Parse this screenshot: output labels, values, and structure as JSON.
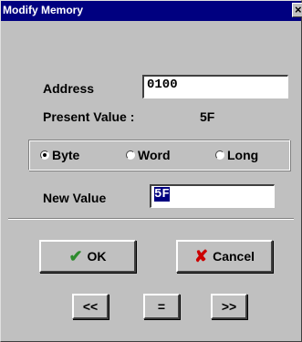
{
  "window": {
    "title": "Modify Memory"
  },
  "icons": {
    "close": "close-icon",
    "ok": "checkmark-icon",
    "cancel": "x-mark-icon"
  },
  "colors": {
    "titlebar": "#000080",
    "face": "#c0c0c0",
    "ok_check": "#2e8b2e",
    "cancel_x": "#cc0000"
  },
  "address": {
    "label": "Address",
    "value": "0100"
  },
  "present": {
    "label": "Present Value :",
    "value": "5F"
  },
  "size_options": [
    {
      "label": "Byte",
      "checked": true
    },
    {
      "label": "Word",
      "checked": false
    },
    {
      "label": "Long",
      "checked": false
    }
  ],
  "new_value": {
    "label": "New Value",
    "value": "5F"
  },
  "buttons": {
    "ok": "OK",
    "cancel": "Cancel",
    "prev": "<<",
    "equal": "=",
    "next": ">>"
  }
}
